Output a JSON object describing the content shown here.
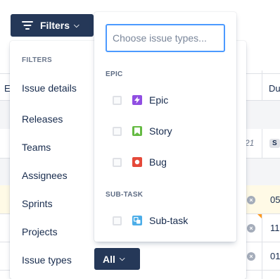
{
  "filters_button": {
    "label": "Filters"
  },
  "filter_panel": {
    "heading": "FILTERS",
    "items": [
      {
        "label": "Issue details"
      },
      {
        "label": "Releases"
      },
      {
        "label": "Teams"
      },
      {
        "label": "Assignees"
      },
      {
        "label": "Sprints"
      },
      {
        "label": "Projects"
      },
      {
        "label": "Issue types"
      }
    ],
    "issue_types_value": "All"
  },
  "issue_type_dropdown": {
    "search_placeholder": "Choose issue types...",
    "groups": [
      {
        "name": "EPIC",
        "options": [
          {
            "label": "Epic",
            "icon": "epic-icon",
            "color": "#904ee2"
          },
          {
            "label": "Story",
            "icon": "story-icon",
            "color": "#65ba43"
          },
          {
            "label": "Bug",
            "icon": "bug-icon",
            "color": "#e5493a"
          }
        ]
      },
      {
        "name": "SUB-TASK",
        "options": [
          {
            "label": "Sub-task",
            "icon": "subtask-icon",
            "color": "#4bade8"
          }
        ]
      }
    ]
  },
  "background_table": {
    "col_e_partial": "E",
    "col_due_partial": "Du",
    "date_partial": "21",
    "chip_label": "S",
    "row_values": [
      "05",
      "11",
      "01"
    ]
  },
  "colors": {
    "button_dark": "#253858",
    "focus_border": "#4c9aff",
    "highlight_row": "#fffae6",
    "flag_orange": "#ff991f"
  }
}
